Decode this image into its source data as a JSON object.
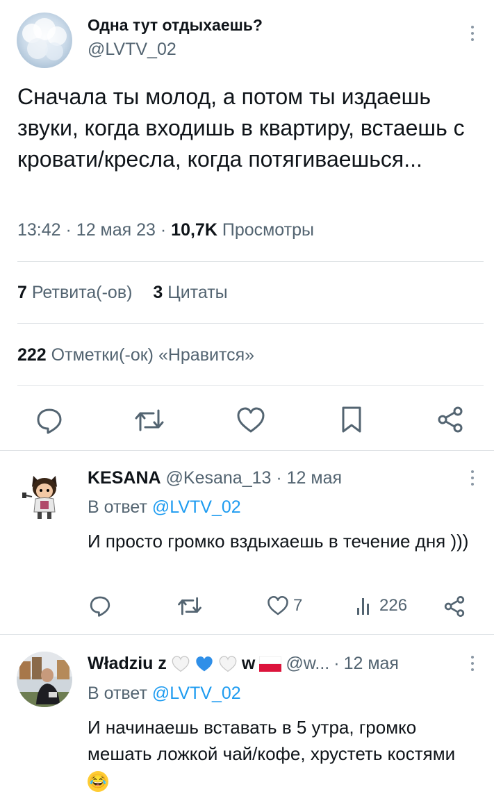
{
  "tweet": {
    "display_name": "Одна тут отдыхаешь?",
    "handle": "@LVTV_02",
    "text": "Сначала ты молод, а потом ты издаешь звуки, когда входишь в квартиру, встаешь с кровати/кресла, когда потягиваешься...",
    "time": "13:42",
    "date": "12 мая 23",
    "views_count": "10,7K",
    "views_label": "Просмотры",
    "retweets_count": "7",
    "retweets_label": "Ретвита(-ов)",
    "quotes_count": "3",
    "quotes_label": "Цитаты",
    "likes_count": "222",
    "likes_label": "Отметки(-ок) «Нравится»"
  },
  "replies": [
    {
      "display_name": "KESANA",
      "handle": "@Kesana_13",
      "date": "12 мая",
      "reply_to_label": "В ответ",
      "reply_to_handle": "@LVTV_02",
      "text": "И просто громко вздыхаешь в течение дня )))",
      "likes": "7",
      "views": "226"
    },
    {
      "display_name": "Władziu z",
      "name_suffix": "w",
      "handle": "@w...",
      "date": "12 мая",
      "reply_to_label": "В ответ",
      "reply_to_handle": "@LVTV_02",
      "text": "И начинаешь вставать в 5 утра, громко мешать ложкой чай/кофе, хрустеть костями",
      "emoji": "😂"
    }
  ],
  "separator": "·",
  "colors": {
    "accent": "#1d9bf0",
    "text": "#0f1419",
    "muted": "#536471",
    "divider": "#dfe3e6"
  }
}
